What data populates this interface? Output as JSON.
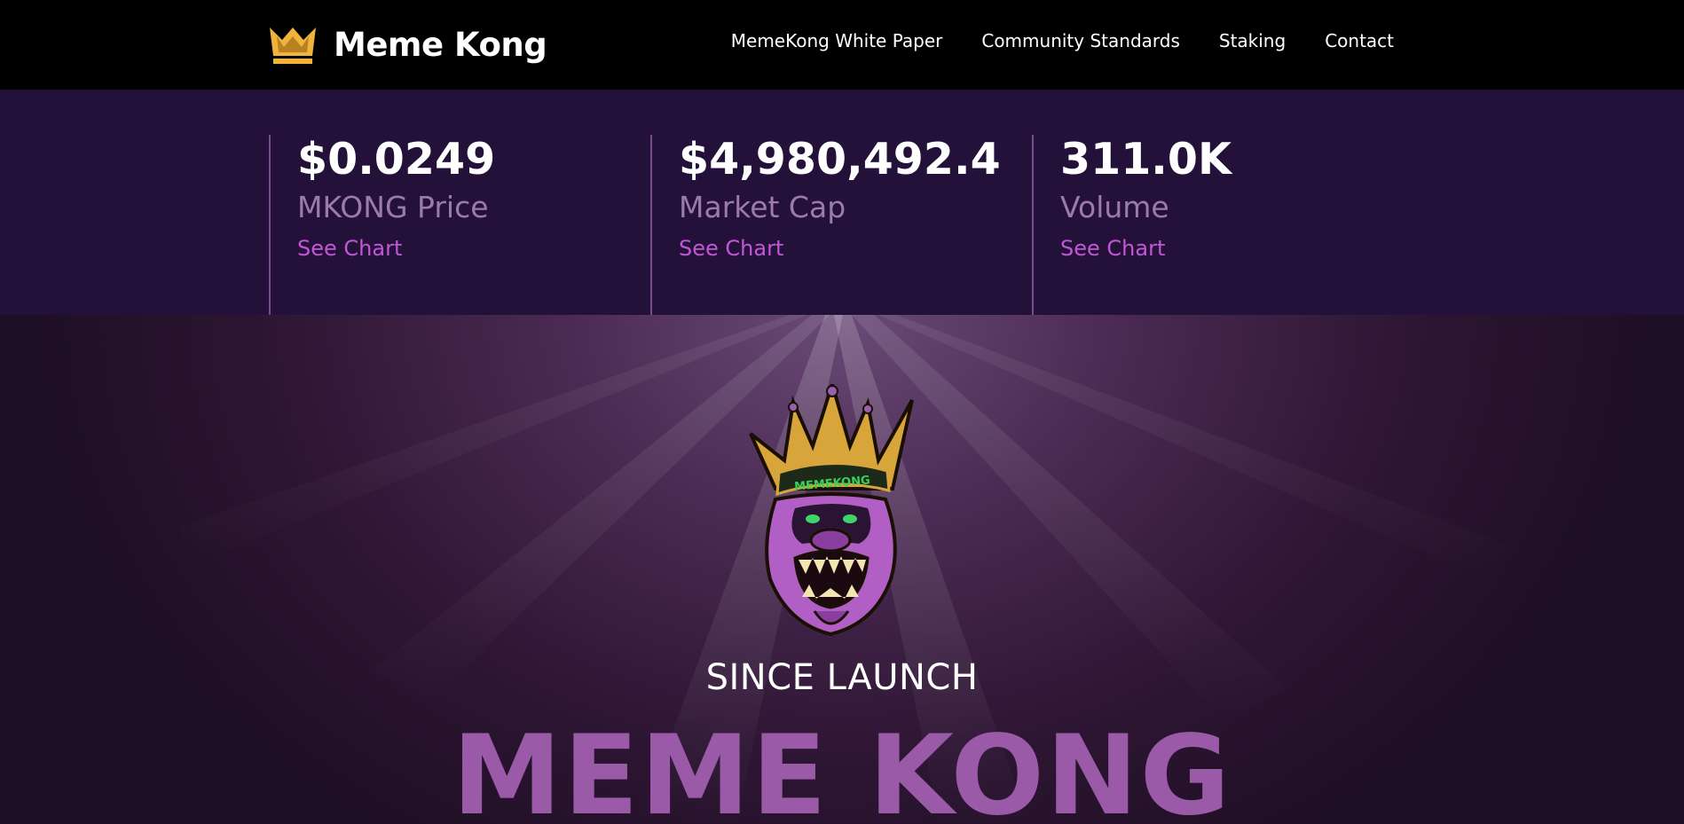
{
  "brand": {
    "name": "Meme Kong",
    "logo_color": "#f0b43a"
  },
  "nav": {
    "items": [
      {
        "label": "MemeKong White Paper"
      },
      {
        "label": "Community Standards"
      },
      {
        "label": "Staking"
      },
      {
        "label": "Contact"
      }
    ]
  },
  "stats": [
    {
      "value": "$0.0249",
      "label": "MKONG Price",
      "link": "See Chart"
    },
    {
      "value": "$4,980,492.4",
      "label": "Market Cap",
      "link": "See Chart"
    },
    {
      "value": "311.0K",
      "label": "Volume",
      "link": "See Chart"
    }
  ],
  "hero": {
    "badge_text": "MEMEKONG",
    "since_text": "SINCE LAUNCH",
    "title": "MEME KONG"
  },
  "colors": {
    "stats_background": "#24113a",
    "accent_link": "#c257d6",
    "title_purple": "#9a5aa8"
  }
}
